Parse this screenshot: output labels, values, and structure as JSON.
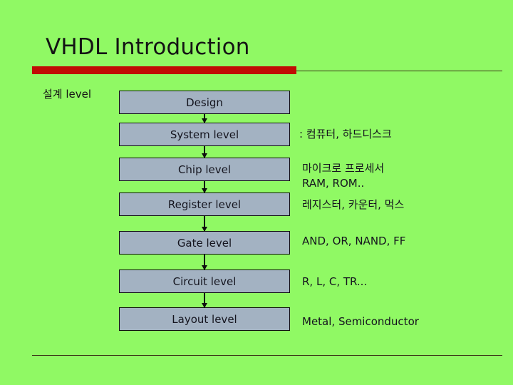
{
  "slide": {
    "title": "VHDL Introduction",
    "background_color": "#90f964",
    "accent_bar_color": "#c00d04",
    "rule_color": "#3a3516",
    "box_fill_color": "#a3b2c2",
    "text_color": "#14141e",
    "left_caption": "설계 level"
  },
  "flow": {
    "boxes": [
      {
        "label": "Design"
      },
      {
        "label": "System level"
      },
      {
        "label": "Chip level"
      },
      {
        "label": "Register level"
      },
      {
        "label": "Gate level"
      },
      {
        "label": "Circuit level"
      },
      {
        "label": "Layout level"
      }
    ]
  },
  "annotations": [
    {
      "text": ": 컴퓨터, 하드디스크"
    },
    {
      "text": "마이크로 프로세서"
    },
    {
      "text": "RAM, ROM.."
    },
    {
      "text": "레지스터, 카운터, 먹스"
    },
    {
      "text": "AND, OR, NAND, FF"
    },
    {
      "text": "R, L, C, TR..."
    },
    {
      "text": "Metal, Semiconductor"
    }
  ]
}
